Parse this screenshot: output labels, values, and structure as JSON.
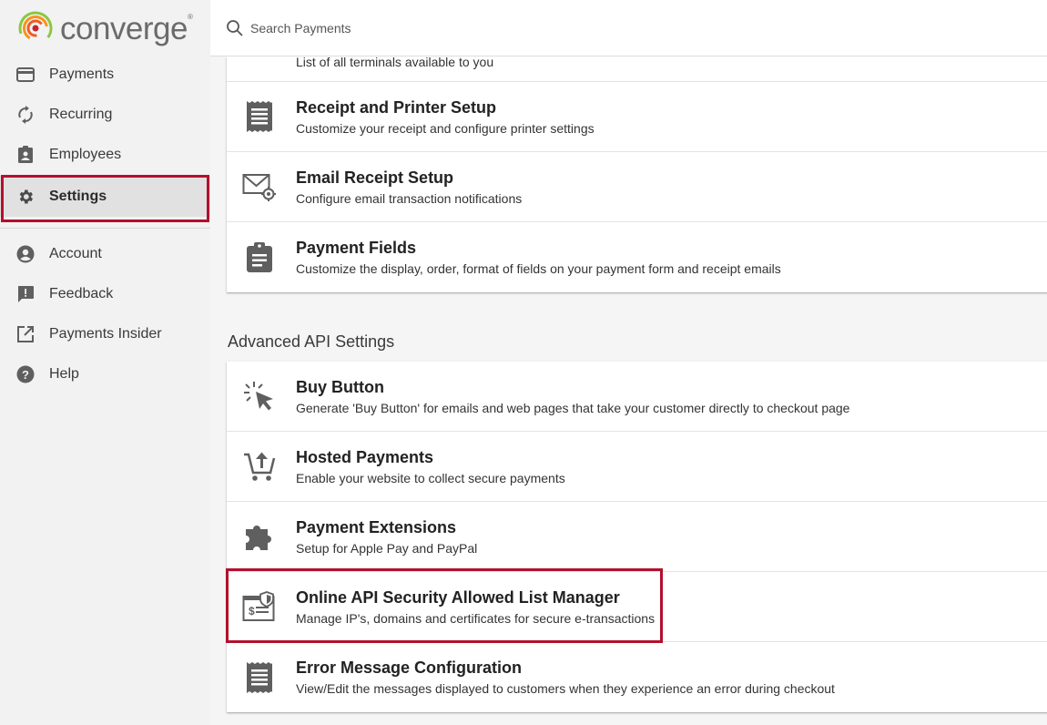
{
  "brand": {
    "name": "converge",
    "trademark": "®"
  },
  "search": {
    "placeholder": "Search Payments"
  },
  "sidebar": {
    "items": [
      {
        "label": "Payments"
      },
      {
        "label": "Recurring"
      },
      {
        "label": "Employees"
      },
      {
        "label": "Settings"
      },
      {
        "label": "Account"
      },
      {
        "label": "Feedback"
      },
      {
        "label": "Payments Insider"
      },
      {
        "label": "Help"
      }
    ],
    "active": "Settings"
  },
  "settings": {
    "partial_row_desc": "List of all terminals available to you",
    "group1": [
      {
        "title": "Receipt and Printer Setup",
        "desc": "Customize your receipt and configure printer settings",
        "icon": "receipt-icon"
      },
      {
        "title": "Email Receipt Setup",
        "desc": "Configure email transaction notifications",
        "icon": "email-settings-icon"
      },
      {
        "title": "Payment Fields",
        "desc": "Customize the display, order, format of fields on your payment form and receipt emails",
        "icon": "clipboard-icon"
      }
    ],
    "advanced_title": "Advanced API Settings",
    "group2": [
      {
        "title": "Buy Button",
        "desc": "Generate 'Buy Button' for emails and web pages that take your customer directly to checkout page",
        "icon": "cursor-click-icon"
      },
      {
        "title": "Hosted Payments",
        "desc": "Enable your website to collect secure payments",
        "icon": "cart-upload-icon"
      },
      {
        "title": "Payment Extensions",
        "desc": "Setup for Apple Pay and PayPal",
        "icon": "puzzle-icon"
      },
      {
        "title": "Online API Security Allowed List Manager",
        "desc": "Manage IP's, domains and certificates for secure e-transactions",
        "icon": "security-certificate-icon"
      },
      {
        "title": "Error Message Configuration",
        "desc": "View/Edit the messages displayed to customers when they experience an error during checkout",
        "icon": "receipt-icon"
      }
    ]
  },
  "colors": {
    "highlight": "#b3102d",
    "icon": "#5f5f5f",
    "logo_green": "#8dc63f",
    "logo_orange": "#f15a24",
    "logo_red": "#c1272d"
  }
}
